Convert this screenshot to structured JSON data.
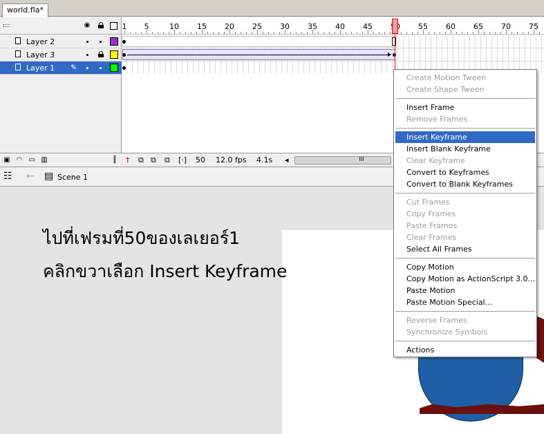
{
  "document_tab": {
    "title": "world.fla*"
  },
  "timeline": {
    "ruler_labels": [
      "1",
      "5",
      "10",
      "15",
      "20",
      "25",
      "30",
      "35",
      "40",
      "45",
      "50",
      "55",
      "60",
      "65",
      "70",
      "75"
    ],
    "current_frame_marker": "50",
    "layers": [
      {
        "name": "Layer 2",
        "swatch_color": "#9a32cd",
        "selected": false,
        "locked": false
      },
      {
        "name": "Layer 3",
        "swatch_color": "#ffff00",
        "selected": false,
        "locked": true
      },
      {
        "name": "Layer 1",
        "swatch_color": "#00ff00",
        "selected": true,
        "locked": false
      }
    ],
    "status": {
      "current_frame": "50",
      "frame_rate": "12.0 fps",
      "elapsed_time": "4.1s",
      "scroll_thumb": "III"
    }
  },
  "scene_bar": {
    "scene_name": "Scene 1"
  },
  "caption": {
    "line1": "ไปที่เฟรมที่50ของเลเยอร์1",
    "line2": "คลิกขวาเลือก Insert Keyframe"
  },
  "context_menu": {
    "items": [
      {
        "label": "Create Motion Tween",
        "enabled": false
      },
      {
        "label": "Create Shape Tween",
        "enabled": false
      },
      {
        "label": "Insert Frame",
        "enabled": true
      },
      {
        "label": "Remove Frames",
        "enabled": false
      },
      {
        "label": "Insert Keyframe",
        "enabled": true,
        "highlighted": true
      },
      {
        "label": "Insert Blank Keyframe",
        "enabled": true
      },
      {
        "label": "Clear Keyframe",
        "enabled": false
      },
      {
        "label": "Convert to Keyframes",
        "enabled": true
      },
      {
        "label": "Convert to Blank Keyframes",
        "enabled": true
      },
      {
        "label": "Cut Frames",
        "enabled": false
      },
      {
        "label": "Copy Frames",
        "enabled": false
      },
      {
        "label": "Paste Frames",
        "enabled": false
      },
      {
        "label": "Clear Frames",
        "enabled": false
      },
      {
        "label": "Select All Frames",
        "enabled": true
      },
      {
        "label": "Copy Motion",
        "enabled": true
      },
      {
        "label": "Copy Motion as ActionScript 3.0...",
        "enabled": true
      },
      {
        "label": "Paste Motion",
        "enabled": true
      },
      {
        "label": "Paste Motion Special...",
        "enabled": true
      },
      {
        "label": "Reverse Frames",
        "enabled": false
      },
      {
        "label": "Synchronize Symbols",
        "enabled": false
      },
      {
        "label": "Actions",
        "enabled": true
      }
    ]
  }
}
